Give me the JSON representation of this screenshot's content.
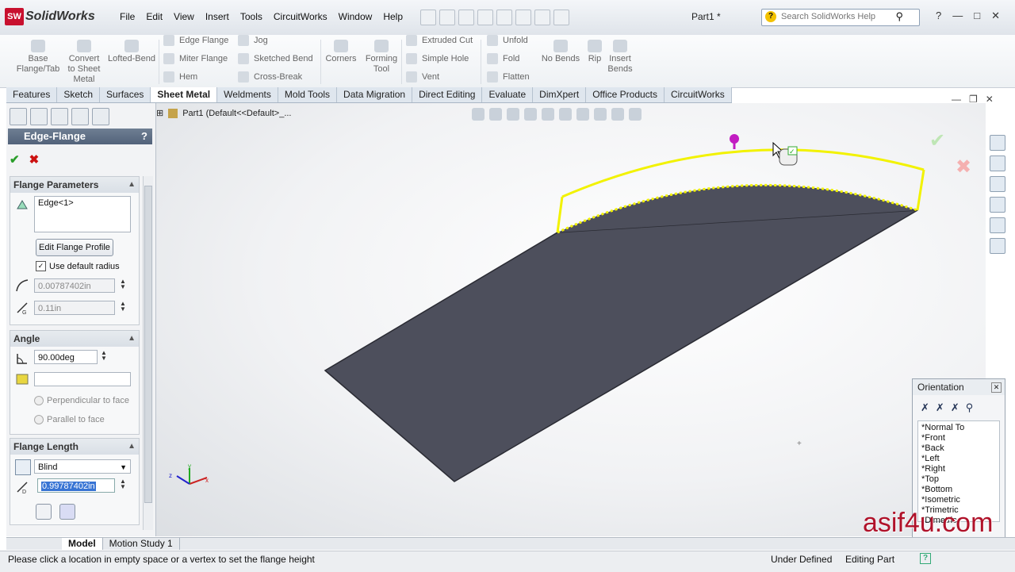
{
  "app": {
    "name": "SolidWorks",
    "logo_text": "SW",
    "doc_title": "Part1 *"
  },
  "menu": [
    "File",
    "Edit",
    "View",
    "Insert",
    "Tools",
    "CircuitWorks",
    "Window",
    "Help"
  ],
  "search": {
    "placeholder": "Search SolidWorks Help"
  },
  "commands": {
    "base_flange": "Base\nFlange/Tab",
    "convert": "Convert\nto Sheet\nMetal",
    "lofted_bend": "Lofted-Bend",
    "edge_flange": "Edge Flange",
    "miter_flange": "Miter Flange",
    "hem": "Hem",
    "jog": "Jog",
    "sketched_bend": "Sketched Bend",
    "cross_break": "Cross-Break",
    "corners": "Corners",
    "forming_tool": "Forming\nTool",
    "extruded_cut": "Extruded Cut",
    "simple_hole": "Simple Hole",
    "vent": "Vent",
    "unfold": "Unfold",
    "fold": "Fold",
    "flatten": "Flatten",
    "no_bends": "No Bends",
    "rip": "Rip",
    "insert_bends": "Insert\nBends"
  },
  "tabs": [
    "Features",
    "Sketch",
    "Surfaces",
    "Sheet Metal",
    "Weldments",
    "Mold Tools",
    "Data Migration",
    "Direct Editing",
    "Evaluate",
    "DimXpert",
    "Office Products",
    "CircuitWorks"
  ],
  "active_tab": "Sheet Metal",
  "feature_tree": {
    "root": "Part1  (Default<<Default>_..."
  },
  "property_manager": {
    "title": "Edge-Flange",
    "help": "?",
    "flange_parameters": {
      "heading": "Flange Parameters",
      "edge_selection": "Edge<1>",
      "edit_profile_button": "Edit Flange Profile",
      "use_default_radius_label": "Use default radius",
      "use_default_radius_checked": true,
      "radius_value": "0.00787402in",
      "gap_value": "0.11in"
    },
    "angle": {
      "heading": "Angle",
      "angle_value": "90.00deg",
      "face_value": "",
      "perpendicular_label": "Perpendicular to face",
      "parallel_label": "Parallel to face"
    },
    "flange_length": {
      "heading": "Flange Length",
      "end_condition": "Blind",
      "length_value": "0.99787402in"
    }
  },
  "orientation": {
    "title": "Orientation",
    "views": [
      "*Normal To",
      "*Front",
      "*Back",
      "*Left",
      "*Right",
      "*Top",
      "*Bottom",
      "*Isometric",
      "*Trimetric",
      "*Dimetric"
    ]
  },
  "bottom_tabs": [
    "Model",
    "Motion Study 1"
  ],
  "status": {
    "message": "Please click a location in empty space or a vertex to set the flange height",
    "state": "Under Defined",
    "mode": "Editing Part"
  },
  "watermark": "asif4u.com",
  "colors": {
    "flange_preview": "#f2f200",
    "plate": "#4d4f5c",
    "title_bar": "#52627a",
    "ok": "#2a9d2a",
    "cancel": "#cc1111"
  },
  "icons": [
    "folder-icon",
    "search-icon",
    "ok-check-icon",
    "cancel-x-icon",
    "triad-icon"
  ]
}
